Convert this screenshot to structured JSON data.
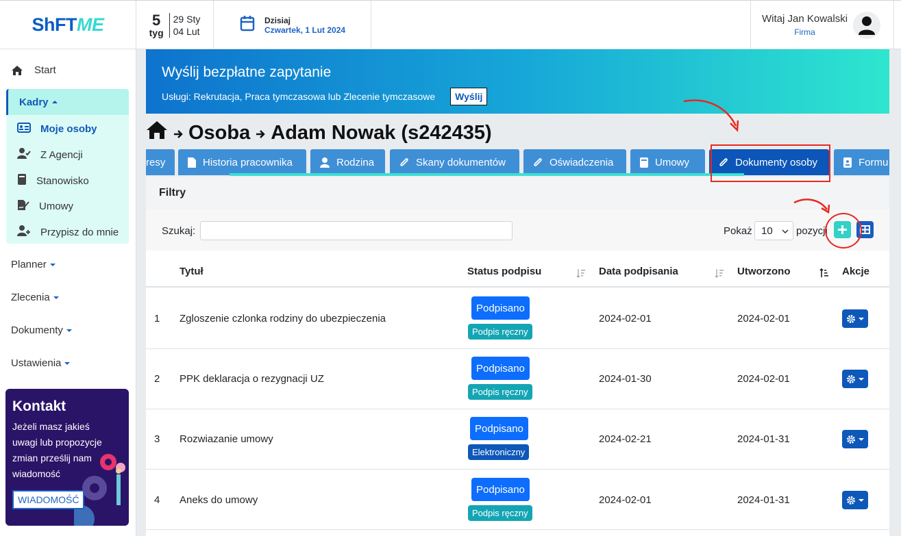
{
  "header": {
    "logo_main": "ShFT",
    "logo_accent": "ME",
    "week_number": "5",
    "week_label": "tyg",
    "week_start": "29 Sty",
    "week_end": "04 Lut",
    "today_label": "Dzisiaj",
    "today_date": "Czwartek, 1 Lut 2024",
    "greeting": "Witaj Jan Kowalski",
    "company": "Firma"
  },
  "sidebar": {
    "start": "Start",
    "kadry": "Kadry",
    "kadry_items": [
      "Moje osoby",
      "Z Agencji",
      "Stanowisko",
      "Umowy",
      "Przypisz do mnie"
    ],
    "menus": [
      "Planner",
      "Zlecenia",
      "Dokumenty",
      "Ustawienia"
    ],
    "contact_title": "Kontakt",
    "contact_text": "Jeżeli masz jakieś uwagi lub propozycje zmian prześlij nam wiadomość",
    "contact_button": "WIADOMOŚĆ"
  },
  "banner": {
    "title": "Wyślij bezpłatne zapytanie",
    "subtitle": "Usługi: Rekrutacja, Praca tymczasowa lub Zlecenie tymczasowe",
    "button": "Wyślij"
  },
  "breadcrumb": {
    "level1": "Osoba",
    "level2": "Adam Nowak (s242435)"
  },
  "tabs": [
    "resy",
    "Historia pracownika",
    "Rodzina",
    "Skany dokumentów",
    "Oświadczenia",
    "Umowy",
    "Dokumenty osoby",
    "Formu"
  ],
  "filters": {
    "title": "Filtry",
    "search_label": "Szukaj:",
    "search_value": "",
    "show_label": "Pokaż",
    "show_value": "10",
    "positions_label": "pozycji"
  },
  "table": {
    "headers": [
      "Tytuł",
      "Status podpisu",
      "Data podpisania",
      "Utworzono",
      "Akcje"
    ],
    "rows": [
      {
        "no": "1",
        "title": "Zgloszenie czlonka rodziny do ubezpieczenia",
        "status": "Podpisano",
        "type": "Podpis ręczny",
        "signed": "2024-02-01",
        "created": "2024-02-01"
      },
      {
        "no": "2",
        "title": "PPK deklaracja o rezygnacji UZ",
        "status": "Podpisano",
        "type": "Podpis ręczny",
        "signed": "2024-01-30",
        "created": "2024-02-01"
      },
      {
        "no": "3",
        "title": "Rozwiazanie umowy",
        "status": "Podpisano",
        "type": "Elektroniczny",
        "signed": "2024-02-21",
        "created": "2024-01-31"
      },
      {
        "no": "4",
        "title": "Aneks do umowy",
        "status": "Podpisano",
        "type": "Podpis ręczny",
        "signed": "2024-02-01",
        "created": "2024-01-31"
      }
    ]
  },
  "colors": {
    "brand_blue": "#0b56b8",
    "accent_teal": "#33d1c6",
    "annotation_red": "#e8281f"
  }
}
